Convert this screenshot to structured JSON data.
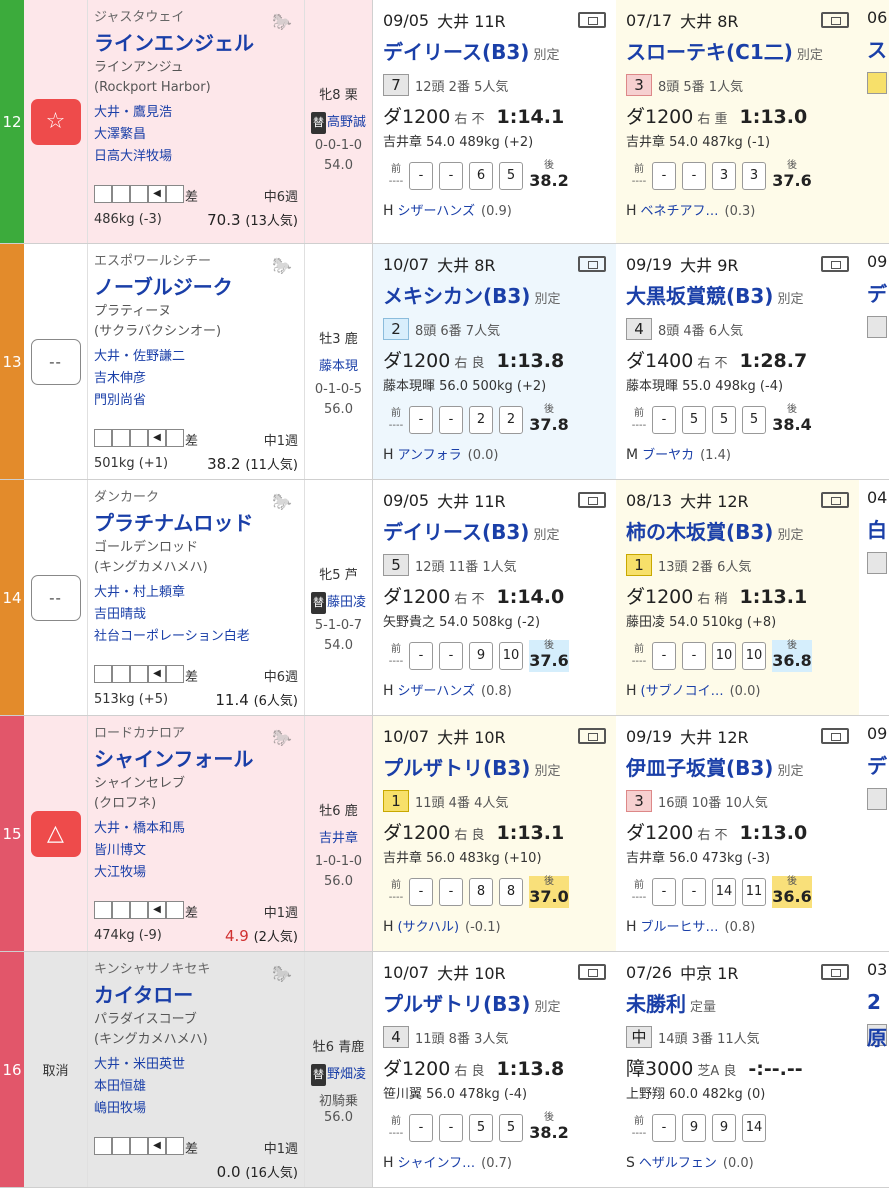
{
  "rows": [
    {
      "num": "12",
      "color": "#3cab3c",
      "bg": "#fde7ea",
      "mark": "☆",
      "mark_type": "red",
      "sire": "ジャスタウェイ",
      "name": "ラインエンジェル",
      "dam": "ラインアンジュ",
      "dam_sire": "(Rockport Harbor)",
      "trainer": "大井・鷹見浩",
      "owner": "大澤繁昌",
      "breeder": "日高大洋牧場",
      "style": "差",
      "rotation": "中6週",
      "weight": "486kg (-3)",
      "odds": "70.3",
      "pop": "(13人気)",
      "odds_red": false,
      "sex_age": "牝8 栗",
      "jockey": "高野誠",
      "jockey_sub": "替",
      "record": "0-0-1-0",
      "kg": "54.0",
      "races": [
        {
          "date": "09/05",
          "venue": "大井 11R",
          "name": "デイリース(B3)",
          "cls": "別定",
          "pos": "7",
          "pos_style": "silver",
          "field": "12頭 2番 5人気",
          "surface": "ダ1200",
          "track": "右 不",
          "time": "1:14.1",
          "detail": "吉井章 54.0 489kg (+2)",
          "corners": [
            "-",
            "-",
            "6",
            "5"
          ],
          "last3": "38.2",
          "last3_hl": "",
          "winner_mark": "H",
          "winner": "シザーハンズ",
          "diff": "(0.9)",
          "bg": "#ffffff"
        },
        {
          "date": "07/17",
          "venue": "大井 8R",
          "name": "スローテキ(C1二)",
          "cls": "別定",
          "pos": "3",
          "pos_style": "bronze",
          "field": "8頭 5番 1人気",
          "surface": "ダ1200",
          "track": "右 重",
          "time": "1:13.0",
          "detail": "吉井章 54.0 487kg (-1)",
          "corners": [
            "-",
            "-",
            "3",
            "3"
          ],
          "last3": "37.6",
          "last3_hl": "",
          "winner_mark": "H",
          "winner": "ベネチアフ…",
          "diff": "(0.3)",
          "bg": "#fefbe9"
        }
      ],
      "edge": {
        "d": "06",
        "n": "ス",
        "bg": "#fefbe9",
        "pos_color": "#f7e06a"
      }
    },
    {
      "num": "13",
      "color": "#e38b2b",
      "bg": "#ffffff",
      "mark": "--",
      "mark_type": "empty",
      "sire": "エスポワールシチー",
      "name": "ノーブルジーク",
      "dam": "プラティーヌ",
      "dam_sire": "(サクラバクシンオー)",
      "trainer": "大井・佐野謙二",
      "owner": "吉木伸彦",
      "breeder": "門別尚省",
      "style": "差",
      "rotation": "中1週",
      "weight": "501kg (+1)",
      "odds": "38.2",
      "pop": "(11人気)",
      "odds_red": false,
      "sex_age": "牡3 鹿",
      "jockey": "藤本現",
      "jockey_sub": "",
      "record": "0-1-0-5",
      "kg": "56.0",
      "races": [
        {
          "date": "10/07",
          "venue": "大井 8R",
          "name": "メキシカン(B3)",
          "cls": "別定",
          "pos": "2",
          "pos_style": "blue",
          "field": "8頭 6番 7人気",
          "surface": "ダ1200",
          "track": "右 良",
          "time": "1:13.8",
          "detail": "藤本現暉 56.0 500kg (+2)",
          "corners": [
            "-",
            "-",
            "2",
            "2"
          ],
          "last3": "37.8",
          "last3_hl": "",
          "winner_mark": "H",
          "winner": "アンフォラ",
          "diff": "(0.0)",
          "bg": "#eef7fd"
        },
        {
          "date": "09/19",
          "venue": "大井 9R",
          "name": "大黒坂賞競(B3)",
          "cls": "別定",
          "pos": "4",
          "pos_style": "silver",
          "field": "8頭 4番 6人気",
          "surface": "ダ1400",
          "track": "右 不",
          "time": "1:28.7",
          "detail": "藤本現暉 55.0 498kg (-4)",
          "corners": [
            "-",
            "5",
            "5",
            "5"
          ],
          "last3": "38.4",
          "last3_hl": "",
          "winner_mark": "M",
          "winner": "ブーヤカ",
          "diff": "(1.4)",
          "bg": "#ffffff"
        }
      ],
      "edge": {
        "d": "09",
        "n": "デ",
        "bg": "#ffffff",
        "pos_color": "#e6e6e6"
      }
    },
    {
      "num": "14",
      "color": "#e38b2b",
      "bg": "#ffffff",
      "mark": "--",
      "mark_type": "empty",
      "sire": "ダンカーク",
      "name": "プラチナムロッド",
      "dam": "ゴールデンロッド",
      "dam_sire": "(キングカメハメハ)",
      "trainer": "大井・村上頼章",
      "owner": "吉田晴哉",
      "breeder": "社台コーポレーション白老",
      "style": "差",
      "rotation": "中6週",
      "weight": "513kg (+5)",
      "odds": "11.4",
      "pop": "(6人気)",
      "odds_red": false,
      "sex_age": "牝5 芦",
      "jockey": "藤田凌",
      "jockey_sub": "替",
      "record": "5-1-0-7",
      "kg": "54.0",
      "races": [
        {
          "date": "09/05",
          "venue": "大井 11R",
          "name": "デイリース(B3)",
          "cls": "別定",
          "pos": "5",
          "pos_style": "silver",
          "field": "12頭 11番 1人気",
          "surface": "ダ1200",
          "track": "右 不",
          "time": "1:14.0",
          "detail": "矢野貴之 54.0 508kg (-2)",
          "corners": [
            "-",
            "-",
            "9",
            "10"
          ],
          "last3": "37.6",
          "last3_hl": "blue",
          "winner_mark": "H",
          "winner": "シザーハンズ",
          "diff": "(0.8)",
          "bg": "#ffffff"
        },
        {
          "date": "08/13",
          "venue": "大井 12R",
          "name": "柿の木坂賞(B3)",
          "cls": "別定",
          "pos": "1",
          "pos_style": "gold",
          "field": "13頭 2番 6人気",
          "surface": "ダ1200",
          "track": "右 稍",
          "time": "1:13.1",
          "detail": "藤田凌 54.0 510kg (+8)",
          "corners": [
            "-",
            "-",
            "10",
            "10"
          ],
          "last3": "36.8",
          "last3_hl": "blue",
          "winner_mark": "H",
          "winner": "(サブノコイ…",
          "diff": "(0.0)",
          "bg": "#fefbe9"
        }
      ],
      "edge": {
        "d": "04",
        "n": "白",
        "bg": "#ffffff",
        "pos_color": "#e6e6e6"
      }
    },
    {
      "num": "15",
      "color": "#e2566a",
      "bg": "#fde7ea",
      "mark": "△",
      "mark_type": "red",
      "sire": "ロードカナロア",
      "name": "シャインフォール",
      "dam": "シャインセレブ",
      "dam_sire": "(クロフネ)",
      "trainer": "大井・橋本和馬",
      "owner": "皆川博文",
      "breeder": "大江牧場",
      "style": "差",
      "rotation": "中1週",
      "weight": "474kg (-9)",
      "odds": "4.9",
      "pop": "(2人気)",
      "odds_red": true,
      "sex_age": "牡6 鹿",
      "jockey": "吉井章",
      "jockey_sub": "",
      "record": "1-0-1-0",
      "kg": "56.0",
      "races": [
        {
          "date": "10/07",
          "venue": "大井 10R",
          "name": "プルザトリ(B3)",
          "cls": "別定",
          "pos": "1",
          "pos_style": "gold",
          "field": "11頭 4番 4人気",
          "surface": "ダ1200",
          "track": "右 良",
          "time": "1:13.1",
          "detail": "吉井章 56.0 483kg (+10)",
          "corners": [
            "-",
            "-",
            "8",
            "8"
          ],
          "last3": "37.0",
          "last3_hl": "yellow",
          "winner_mark": "H",
          "winner": "(サクハル)",
          "diff": "(-0.1)",
          "bg": "#fefbe9"
        },
        {
          "date": "09/19",
          "venue": "大井 12R",
          "name": "伊皿子坂賞(B3)",
          "cls": "別定",
          "pos": "3",
          "pos_style": "bronze",
          "field": "16頭 10番 10人気",
          "surface": "ダ1200",
          "track": "右 不",
          "time": "1:13.0",
          "detail": "吉井章 56.0 473kg (-3)",
          "corners": [
            "-",
            "-",
            "14",
            "11"
          ],
          "last3": "36.6",
          "last3_hl": "yellow",
          "winner_mark": "H",
          "winner": "ブルーヒサ…",
          "diff": "(0.8)",
          "bg": "#ffffff"
        }
      ],
      "edge": {
        "d": "09",
        "n": "デ",
        "bg": "#ffffff",
        "pos_color": "#e6e6e6"
      }
    },
    {
      "num": "16",
      "color": "#e2566a",
      "bg": "#e6e6e6",
      "mark": "取消",
      "mark_type": "text",
      "sire": "キンシャサノキセキ",
      "name": "カイタロー",
      "dam": "パラダイスコーブ",
      "dam_sire": "(キングカメハメハ)",
      "trainer": "大井・米田英世",
      "owner": "本田恒雄",
      "breeder": "嶋田牧場",
      "style": "差",
      "rotation": "中1週",
      "weight": "",
      "odds": "0.0",
      "pop": "(16人気)",
      "odds_red": false,
      "sex_age": "牡6 青鹿",
      "jockey": "野畑凌",
      "jockey_sub": "替",
      "record": "初騎乗",
      "kg": "56.0",
      "races": [
        {
          "date": "10/07",
          "venue": "大井 10R",
          "name": "プルザトリ(B3)",
          "cls": "別定",
          "pos": "4",
          "pos_style": "silver",
          "field": "11頭 8番 3人気",
          "surface": "ダ1200",
          "track": "右 良",
          "time": "1:13.8",
          "detail": "笹川翼 56.0 478kg (-4)",
          "corners": [
            "-",
            "-",
            "5",
            "5"
          ],
          "last3": "38.2",
          "last3_hl": "",
          "winner_mark": "H",
          "winner": "シャインフ…",
          "diff": "(0.7)",
          "bg": "#ffffff"
        },
        {
          "date": "07/26",
          "venue": "中京 1R",
          "name": "未勝利",
          "cls": "定量",
          "pos": "中",
          "pos_style": "silver",
          "field": "14頭 3番 11人気",
          "surface": "障3000",
          "track": "芝A 良",
          "time": "-:--.--",
          "detail": "上野翔 60.0 482kg (0)",
          "corners": [
            "-",
            "9",
            "9",
            "14"
          ],
          "last3": "",
          "last3_hl": "",
          "winner_mark": "S",
          "winner": "ヘザルフェン",
          "diff": "(0.0)",
          "bg": "#ffffff"
        }
      ],
      "edge": {
        "d": "03",
        "n": "2原",
        "bg": "#ffffff",
        "pos_color": "#e6e6e6"
      }
    }
  ],
  "labels": {
    "prefix": "前",
    "suffix": "後",
    "dashes": "----"
  }
}
